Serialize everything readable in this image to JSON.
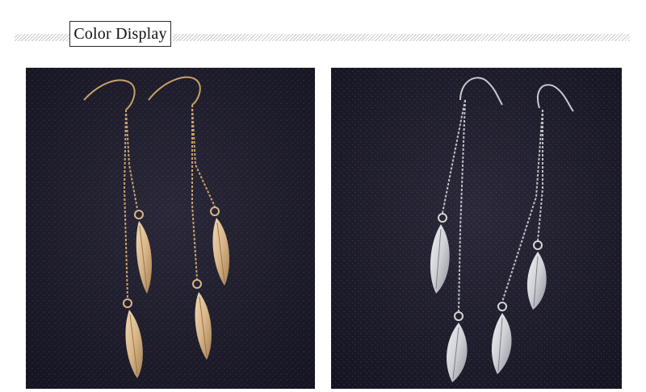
{
  "header": {
    "title": "Color Display"
  },
  "photos": [
    {
      "variant": "gold",
      "metal_color": "#d8b68a",
      "chain_color": "#c9a26b"
    },
    {
      "variant": "silver",
      "metal_color": "#d6d6da",
      "chain_color": "#bfc0c6"
    }
  ],
  "colors": {
    "background": "#1b1a2a",
    "frame": "#2b2b2b"
  }
}
